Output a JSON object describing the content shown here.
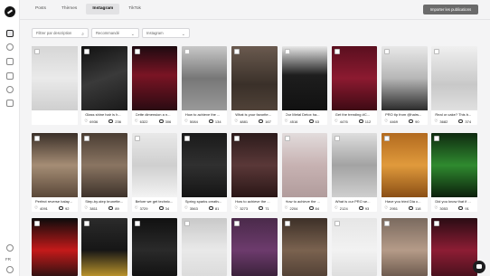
{
  "tabs": [
    "Posts",
    "Thèmes",
    "Instagram",
    "TikTok"
  ],
  "active_tab": 2,
  "import_button": "Importer les publications",
  "filters": {
    "search_placeholder": "Filtrer par description",
    "sort": "Recommandé",
    "type": "Instagram"
  },
  "language": "FR",
  "posts": [
    {
      "caption": "At The Met Gala, m...",
      "likes": "57915",
      "comments": "73",
      "bg": "linear-gradient(180deg,#2a2a2a,#8a8a8a 55%,#3b3b3b)"
    },
    {
      "caption": "Glass shine hair is h...",
      "likes": "6936",
      "comments": "236",
      "bg": "linear-gradient(160deg,#111,#3a3a3a 50%,#1a1a1a)"
    },
    {
      "caption": "Cette dimension a n...",
      "likes": "6322",
      "comments": "306",
      "bg": "linear-gradient(180deg,#1d0a10,#7a1424 45%,#2a0b12)"
    },
    {
      "caption": "How to achieve the ...",
      "likes": "5084",
      "comments": "134",
      "bg": "linear-gradient(180deg,#c8c8c8,#777 50%,#999)"
    },
    {
      "caption": "What is your favorite...",
      "likes": "4881",
      "comments": "167",
      "bg": "linear-gradient(180deg,#6a5a4f,#3a3029 60%,#504238)"
    },
    {
      "caption": "Our Metal Detox ha...",
      "likes": "4516",
      "comments": "63",
      "bg": "linear-gradient(180deg,#e8e8e8,#1e1e1e 45%,#111)"
    },
    {
      "caption": "Get the trending #C...",
      "likes": "4476",
      "comments": "112",
      "bg": "linear-gradient(180deg,#5a0f1f,#8c1a30 50%,#3e0a14)"
    },
    {
      "caption": "PRO tip from @hairs...",
      "likes": "4469",
      "comments": "90",
      "bg": "linear-gradient(180deg,#e8e8e8,#b7b7b7 50%,#2b2b2b)"
    },
    {
      "caption": "Real or cake? This b...",
      "likes": "3682",
      "comments": "374",
      "bg": "linear-gradient(180deg,#f0f0f0,#c8c8c8 60%,#e0e0e0)"
    },
    {
      "caption": "Perfect reverse balay...",
      "likes": "4091",
      "comments": "92",
      "bg": "linear-gradient(180deg,#3a2f28,#a58d75 50%,#5a4839)"
    },
    {
      "caption": "Step-by-step brunette...",
      "likes": "3811",
      "comments": "89",
      "bg": "linear-gradient(180deg,#4a3d33,#8a7562 50%,#3d322a)"
    },
    {
      "caption": "Before we get technic...",
      "likes": "3729",
      "comments": "34",
      "bg": "linear-gradient(180deg,#e9e9e9,#cfcfcf 50%,#f3f3f3)"
    },
    {
      "caption": "Spring sparks creativ...",
      "likes": "3563",
      "comments": "81",
      "bg": "linear-gradient(180deg,#1a1a1a,#303030 50%,#151515)"
    },
    {
      "caption": "How to achieve the ...",
      "likes": "3273",
      "comments": "71",
      "bg": "linear-gradient(180deg,#2c1b1b,#5a3838 50%,#2a1616)"
    },
    {
      "caption": "How to achieve the ...",
      "likes": "2204",
      "comments": "84",
      "bg": "linear-gradient(180deg,#e2dcdc,#c7b2b2 50%,#b19c9c)"
    },
    {
      "caption": "What is our PRO se...",
      "likes": "2124",
      "comments": "93",
      "bg": "linear-gradient(180deg,#dedede,#a3a3a3 50%,#cfcfcf)"
    },
    {
      "caption": "Have you tried Dia c...",
      "likes": "2951",
      "comments": "118",
      "bg": "linear-gradient(180deg,#b26a1f,#e09a3c 50%,#8a4f15)"
    },
    {
      "caption": "Did you know that if ...",
      "likes": "3053",
      "comments": "91",
      "bg": "linear-gradient(180deg,#0f2a10,#2f8a2f 50%,#0c1f0c)"
    },
    {
      "caption": "",
      "likes": "",
      "comments": "",
      "bg": "linear-gradient(180deg,#0b0b0b,#c41a1a 50%,#101010)"
    },
    {
      "caption": "",
      "likes": "",
      "comments": "",
      "bg": "linear-gradient(180deg,#2b2b2b,#161616 50%,#e0b030)"
    },
    {
      "caption": "",
      "likes": "",
      "comments": "",
      "bg": "linear-gradient(180deg,#111,#2a2a2a 50%,#0d0d0d)"
    },
    {
      "caption": "",
      "likes": "",
      "comments": "",
      "bg": "linear-gradient(180deg,#c9c9c9,#e9e9e9 50%,#d8d8d8)"
    },
    {
      "caption": "",
      "likes": "",
      "comments": "",
      "bg": "linear-gradient(180deg,#4a2a4a,#6d3b6d 50%,#2f1c2f)"
    },
    {
      "caption": "",
      "likes": "",
      "comments": "",
      "bg": "linear-gradient(180deg,#3d3028,#7a624f 50%,#4a3a30)"
    },
    {
      "caption": "",
      "likes": "",
      "comments": "",
      "bg": "linear-gradient(180deg,#e6e6e6,#f2f2f2 50%,#d9d9d9)"
    },
    {
      "caption": "",
      "likes": "",
      "comments": "",
      "bg": "linear-gradient(180deg,#7a6a5f,#b59b88 50%,#5d4c42)"
    },
    {
      "caption": "",
      "likes": "",
      "comments": "",
      "bg": "linear-gradient(180deg,#2a0c14,#8d1d34 50%,#3a0e18)"
    },
    {
      "caption": "",
      "likes": "",
      "comments": "",
      "bg": "linear-gradient(180deg,#d6d6d6,#eaeaea 50%,#cfcfcf)"
    }
  ]
}
